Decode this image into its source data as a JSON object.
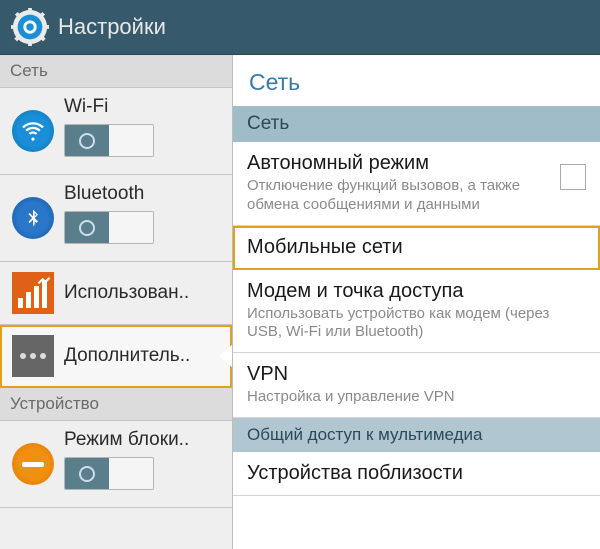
{
  "header": {
    "title": "Настройки"
  },
  "sidebar": {
    "sections": [
      {
        "header": "Сеть",
        "items": [
          {
            "label": "Wi-Fi",
            "toggle": true,
            "icon": "wifi"
          },
          {
            "label": "Bluetooth",
            "toggle": true,
            "icon": "bluetooth"
          },
          {
            "label": "Использован..",
            "toggle": false,
            "icon": "data-usage"
          },
          {
            "label": "Дополнитель..",
            "toggle": false,
            "icon": "more",
            "selected": true
          }
        ]
      },
      {
        "header": "Устройство",
        "items": [
          {
            "label": "Режим блоки..",
            "toggle": true,
            "icon": "block"
          }
        ]
      }
    ]
  },
  "main": {
    "title": "Сеть",
    "sections": [
      {
        "header": "Сеть",
        "items": [
          {
            "title": "Автономный режим",
            "sub": "Отключение функций вызовов, а также обмена сообщениями и данными",
            "checkbox": true
          },
          {
            "title": "Мобильные сети",
            "highlighted": true
          },
          {
            "title": "Модем и точка доступа",
            "sub": "Использовать устройство как модем (через USB, Wi-Fi или Bluetooth)"
          },
          {
            "title": "VPN",
            "sub": "Настройка и управление VPN"
          }
        ]
      },
      {
        "header": "Общий доступ к мультимедиа",
        "items": [
          {
            "title": "Устройства поблизости"
          }
        ]
      }
    ]
  }
}
